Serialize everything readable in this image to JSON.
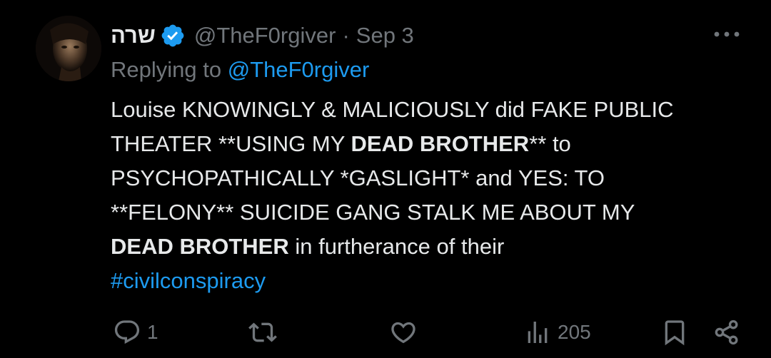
{
  "tweet": {
    "author": {
      "display_name": "שרה",
      "handle": "@TheF0rgiver",
      "verified": true,
      "avatar_icon": "user-avatar"
    },
    "separator": "·",
    "date": "Sep 3",
    "more_icon": "ellipsis-icon",
    "replying_to": {
      "prefix": "Replying to",
      "handle": "@TheF0rgiver"
    },
    "body": {
      "l1": "Louise KNOWINGLY & MALICIOUSLY did FAKE PUBLIC",
      "l2a": "THEATER **USING MY ",
      "l2b": "DEAD BROTHER",
      "l2c": "** to",
      "l3": "PSYCHOPATHICALLY *GASLIGHT* and YES: TO",
      "l4": "**FELONY** SUICIDE GANG STALK ME ABOUT MY",
      "l5a": "DEAD BROTHER",
      "l5b": " in furtherance of their",
      "hashtag": "#civilconspiracy"
    },
    "actions": {
      "reply": {
        "icon": "reply-icon",
        "count": "1"
      },
      "retweet": {
        "icon": "retweet-icon",
        "count": ""
      },
      "like": {
        "icon": "heart-icon",
        "count": ""
      },
      "views": {
        "icon": "views-chart-icon",
        "count": "205"
      },
      "bookmark": {
        "icon": "bookmark-icon"
      },
      "share": {
        "icon": "share-icon"
      }
    },
    "colors": {
      "background": "#000000",
      "text": "#e7e9ea",
      "secondary": "#71767b",
      "accent": "#1d9bf0"
    }
  }
}
